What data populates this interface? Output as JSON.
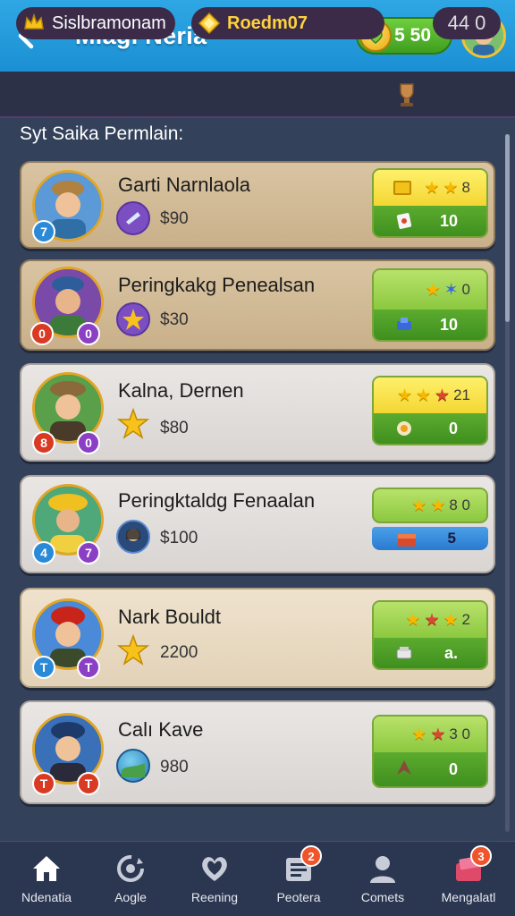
{
  "header": {
    "title": "Mlagi Neria",
    "coins": "5 50",
    "back_icon": "arrow-left-icon"
  },
  "statusbar": {
    "pill1": "Sislbramonam",
    "pill2": "Roedm07",
    "pill3": "44 0"
  },
  "section_title": "Syt Saika Permlain:",
  "cards": [
    {
      "name": "Garti Narnlaola",
      "price": "$90",
      "badge1": "7",
      "badge2": "",
      "reward_top": "8",
      "reward_bottom": "10"
    },
    {
      "name": "Peringkakg Penealsan",
      "price": "$30",
      "badge1": "0",
      "badge2": "0",
      "reward_top": "0",
      "reward_bottom": "10"
    },
    {
      "name": "Kalna, Dernen",
      "price": "$80",
      "badge1": "8",
      "badge2": "0",
      "reward_top": "21",
      "reward_bottom": "0"
    },
    {
      "name": "Peringktaldg Fenaalan",
      "price": "$100",
      "badge1": "4",
      "badge2": "7",
      "reward_top": "8 0",
      "reward_bottom": "5"
    },
    {
      "name": "Nark Bouldt",
      "price": "2200",
      "badge1": "T",
      "badge2": "T",
      "reward_top": "2",
      "reward_bottom": "a."
    },
    {
      "name": "Calı Kave",
      "price": "980",
      "badge1": "T",
      "badge2": "T",
      "reward_top": "3 0",
      "reward_bottom": "0"
    }
  ],
  "nav": [
    {
      "label": "Ndenatia",
      "icon": "home-icon",
      "badge": ""
    },
    {
      "label": "Aogle",
      "icon": "refresh-icon",
      "badge": ""
    },
    {
      "label": "Reening",
      "icon": "heart-icon",
      "badge": ""
    },
    {
      "label": "Peotera",
      "icon": "list-icon",
      "badge": "2"
    },
    {
      "label": "Comets",
      "icon": "person-icon",
      "badge": ""
    },
    {
      "label": "Mengalatl",
      "icon": "gift-icon",
      "badge": "3"
    }
  ]
}
